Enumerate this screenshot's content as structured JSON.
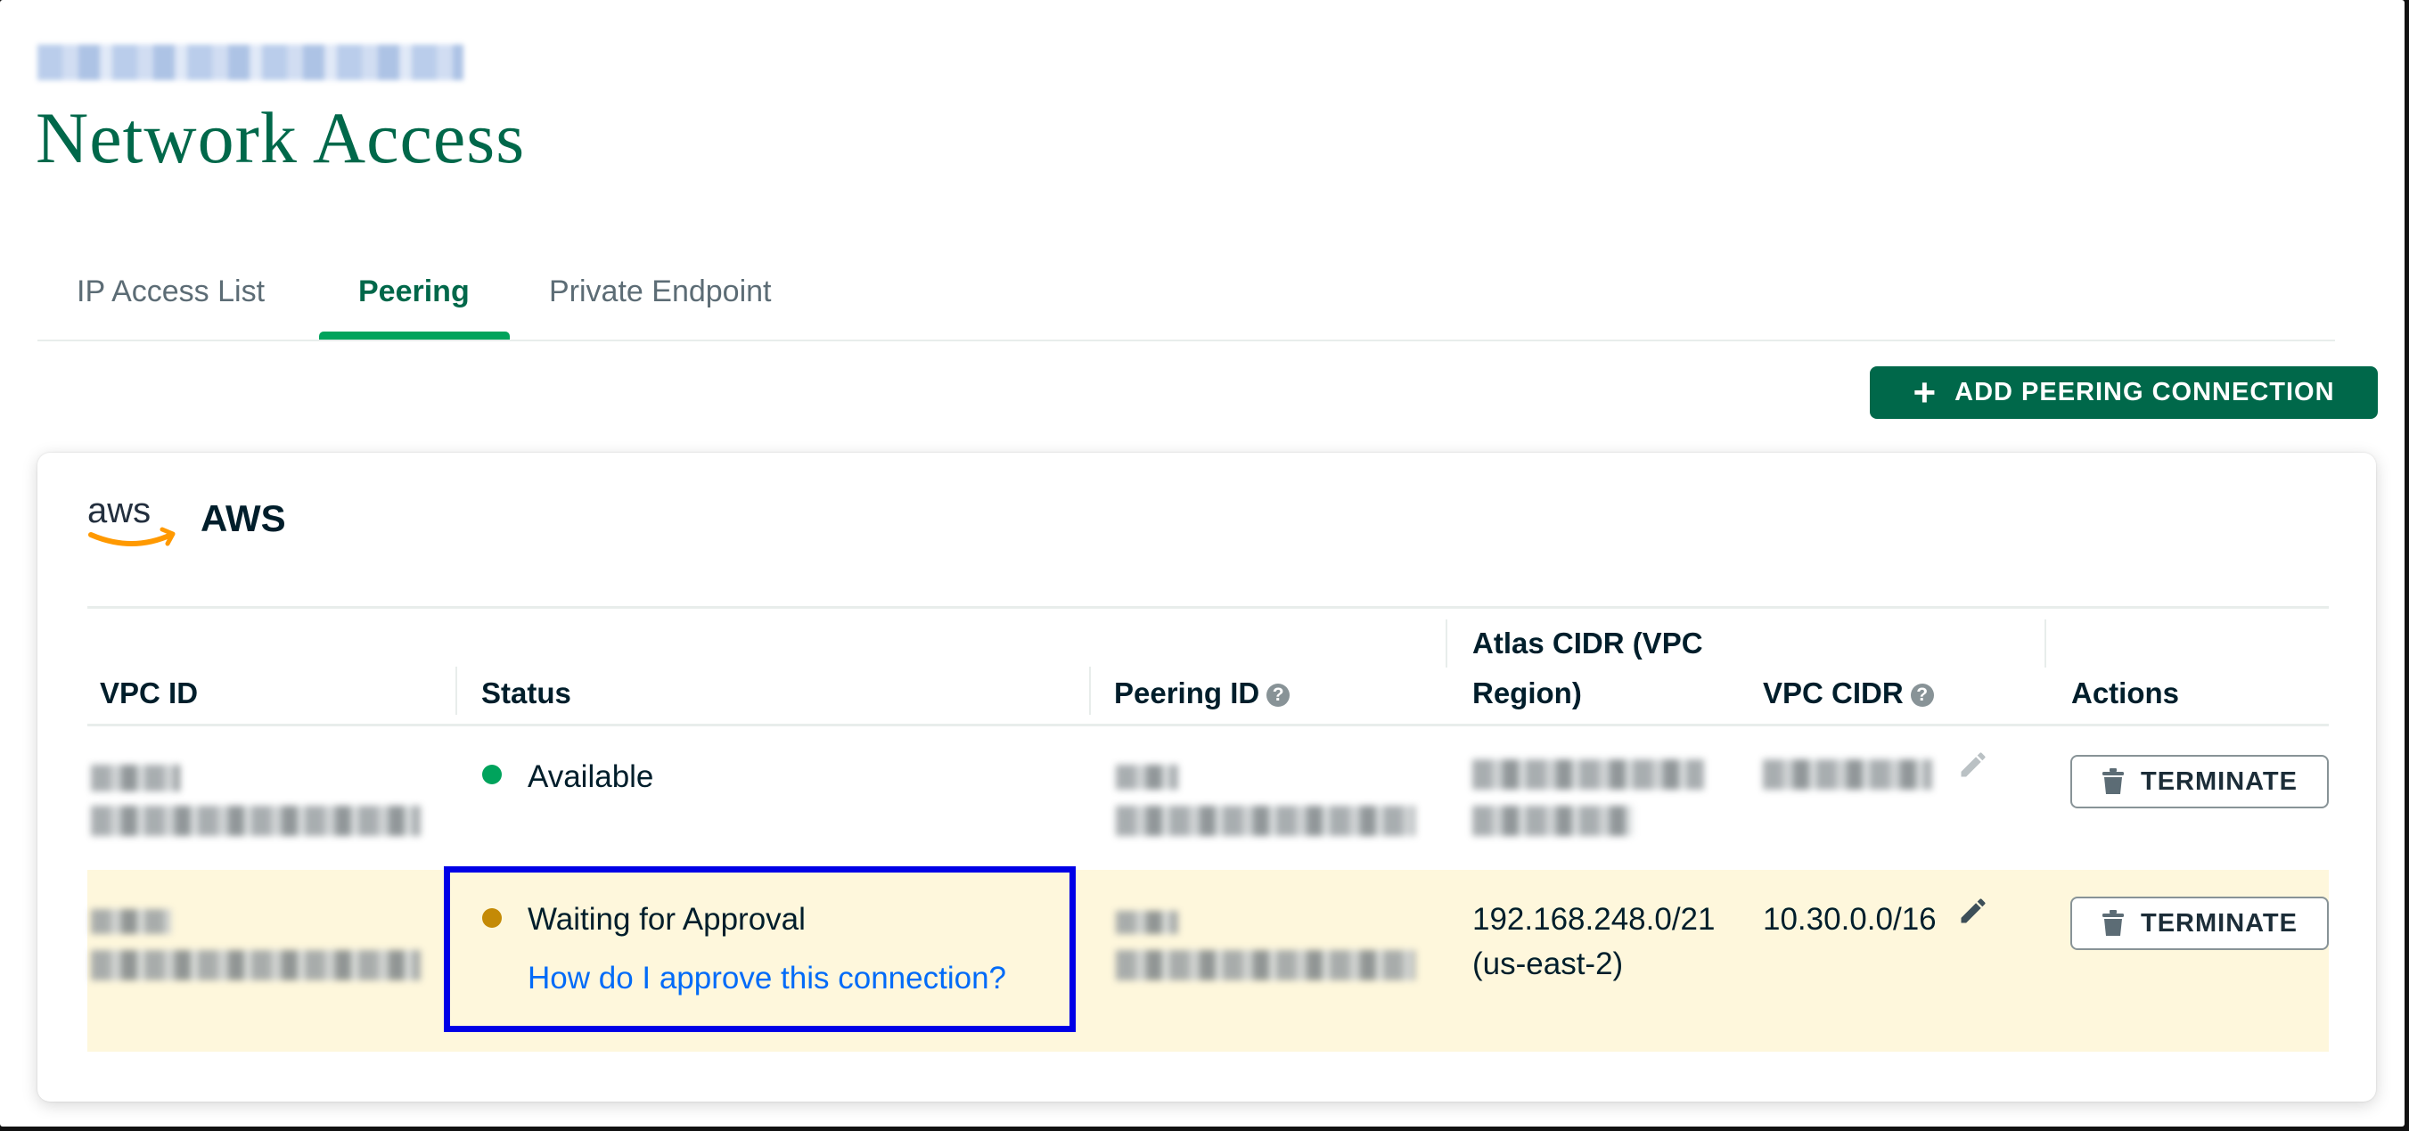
{
  "page": {
    "title": "Network Access",
    "breadcrumb_redacted": true
  },
  "tabs": [
    {
      "label": "IP Access List",
      "active": false
    },
    {
      "label": "Peering",
      "active": true
    },
    {
      "label": "Private Endpoint",
      "active": false
    }
  ],
  "toolbar": {
    "add_button_label": "ADD PEERING CONNECTION",
    "add_button_icon": "plus-icon"
  },
  "provider": {
    "logo_text": "aws",
    "name": "AWS"
  },
  "table": {
    "columns": {
      "vpc_id": "VPC ID",
      "status": "Status",
      "peering_id": "Peering ID",
      "atlas_cidr_line1": "Atlas CIDR (VPC",
      "atlas_cidr_line2": "Region)",
      "vpc_cidr": "VPC CIDR",
      "actions": "Actions"
    },
    "help_icon_glyph": "?",
    "rows": [
      {
        "status": "Available",
        "status_color": "#00a35c",
        "atlas_cidr_redacted": true,
        "vpc_cidr_redacted": true,
        "action_label": "TERMINATE"
      },
      {
        "status": "Waiting for Approval",
        "status_color": "#c48a06",
        "help_link": "How do I approve this connection?",
        "atlas_cidr_line1": "192.168.248.0/21",
        "atlas_cidr_line2": "(us-east-2)",
        "vpc_cidr": "10.30.0.0/16",
        "action_label": "TERMINATE",
        "highlighted": true
      }
    ]
  },
  "colors": {
    "brand_green": "#00684a",
    "tab_active_underline": "#00a35c",
    "link_blue": "#016bf8",
    "highlight_row_bg": "#fef7dc",
    "annotation_box": "#0000e6"
  }
}
